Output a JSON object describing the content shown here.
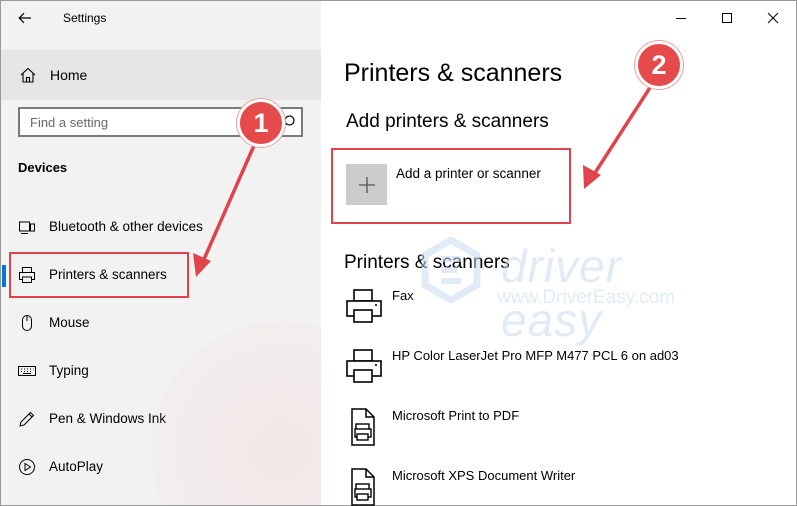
{
  "window": {
    "title": "Settings",
    "controls": {
      "minimize": "minimize-icon",
      "maximize": "maximize-icon",
      "close": "close-icon"
    }
  },
  "sidebar": {
    "home_label": "Home",
    "search_placeholder": "Find a setting",
    "section_title": "Devices",
    "items": [
      {
        "label": "Bluetooth & other devices",
        "icon": "bluetooth-devices-icon"
      },
      {
        "label": "Printers & scanners",
        "icon": "printer-icon",
        "active": true
      },
      {
        "label": "Mouse",
        "icon": "mouse-icon"
      },
      {
        "label": "Typing",
        "icon": "keyboard-icon"
      },
      {
        "label": "Pen & Windows Ink",
        "icon": "pen-icon"
      },
      {
        "label": "AutoPlay",
        "icon": "autoplay-icon"
      }
    ]
  },
  "main": {
    "page_title": "Printers & scanners",
    "add_heading": "Add printers & scanners",
    "add_button_label": "Add a printer or scanner",
    "list_heading": "Printers & scanners",
    "printers": [
      {
        "name": "Fax",
        "icon": "printer-icon"
      },
      {
        "name": "HP Color LaserJet Pro MFP M477 PCL 6 on ad03",
        "icon": "printer-icon"
      },
      {
        "name": "Microsoft Print to PDF",
        "icon": "document-printer-icon"
      },
      {
        "name": "Microsoft XPS Document Writer",
        "icon": "document-printer-icon"
      }
    ]
  },
  "annotations": {
    "step1": "1",
    "step2": "2",
    "color": "#e54b4b"
  },
  "watermark": {
    "brand": "driver easy",
    "url": "www.DriverEasy.com"
  },
  "colors": {
    "accent": "#0078d7",
    "sidebar_bg": "#f2f2f2",
    "highlight": "#e0434b"
  }
}
